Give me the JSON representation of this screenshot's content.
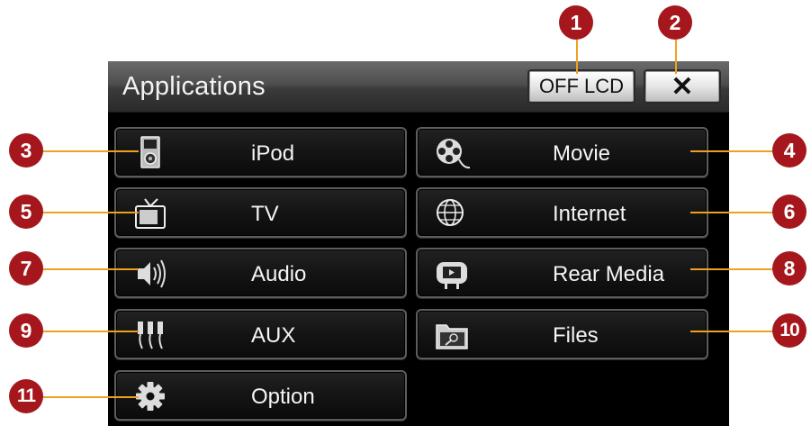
{
  "window": {
    "title": "Applications"
  },
  "toolbar": {
    "off_lcd_label": "OFF LCD",
    "close_label": "✕"
  },
  "apps": [
    {
      "label": "iPod",
      "icon": "ipod-icon"
    },
    {
      "label": "Movie",
      "icon": "film-reel-icon"
    },
    {
      "label": "TV",
      "icon": "tv-icon"
    },
    {
      "label": "Internet",
      "icon": "globe-icon"
    },
    {
      "label": "Audio",
      "icon": "speaker-icon"
    },
    {
      "label": "Rear Media",
      "icon": "headrest-screen-icon"
    },
    {
      "label": "AUX",
      "icon": "rca-plug-icon"
    },
    {
      "label": "Files",
      "icon": "folder-icon"
    },
    {
      "label": "Option",
      "icon": "gear-icon"
    }
  ],
  "callouts": [
    "1",
    "2",
    "3",
    "4",
    "5",
    "6",
    "7",
    "8",
    "9",
    "10",
    "11"
  ],
  "colors": {
    "callout": "#a5171d",
    "leader": "#f0a020",
    "screen": "#000000"
  }
}
